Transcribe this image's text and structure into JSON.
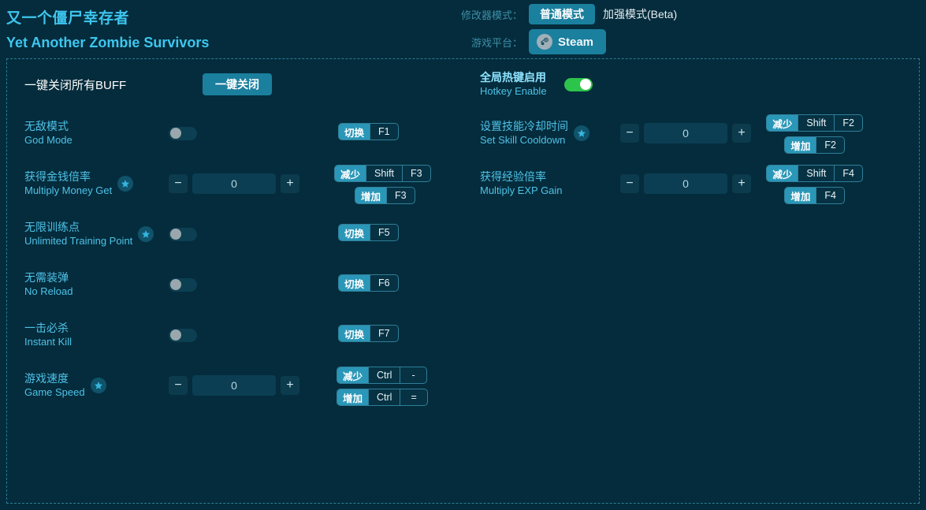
{
  "header": {
    "title_zh": "又一个僵尸幸存者",
    "title_en": "Yet Another Zombie Survivors",
    "mode_label": "修改器模式：",
    "mode_normal": "普通模式",
    "mode_enhanced": "加强模式(Beta)",
    "platform_label": "游戏平台：",
    "platform_value": "Steam",
    "platform_icon": "steam-icon"
  },
  "left": {
    "close_all_label": "一键关闭所有BUFF",
    "close_all_button": "一键关闭",
    "rows": [
      {
        "zh": "无敌模式",
        "en": "God Mode",
        "star": false,
        "control": "toggle",
        "toggle_on": false,
        "hotkeys": [
          {
            "action": "切换",
            "keys": [
              "F1"
            ]
          }
        ]
      },
      {
        "zh": "获得金钱倍率",
        "en": "Multiply Money Get",
        "star": true,
        "control": "stepper",
        "value": "0",
        "minus": "−",
        "plus": "+",
        "hotkeys": [
          {
            "action": "减少",
            "keys": [
              "Shift",
              "F3"
            ]
          },
          {
            "action": "增加",
            "keys": [
              "F3"
            ]
          }
        ]
      },
      {
        "zh": "无限训练点",
        "en": "Unlimited Training Point",
        "star": true,
        "control": "toggle",
        "toggle_on": false,
        "hotkeys": [
          {
            "action": "切换",
            "keys": [
              "F5"
            ]
          }
        ]
      },
      {
        "zh": "无需装弹",
        "en": "No Reload",
        "star": false,
        "control": "toggle",
        "toggle_on": false,
        "hotkeys": [
          {
            "action": "切换",
            "keys": [
              "F6"
            ]
          }
        ]
      },
      {
        "zh": "一击必杀",
        "en": "Instant Kill",
        "star": false,
        "control": "toggle",
        "toggle_on": false,
        "hotkeys": [
          {
            "action": "切换",
            "keys": [
              "F7"
            ]
          }
        ]
      },
      {
        "zh": "游戏速度",
        "en": "Game Speed",
        "star": true,
        "control": "stepper",
        "value": "0",
        "minus": "−",
        "plus": "+",
        "hotkeys": [
          {
            "action": "减少",
            "keys": [
              "Ctrl",
              "-"
            ]
          },
          {
            "action": "增加",
            "keys": [
              "Ctrl",
              "="
            ]
          }
        ]
      }
    ]
  },
  "right": {
    "hotkey_enable_zh": "全局热键启用",
    "hotkey_enable_en": "Hotkey Enable",
    "hotkey_enable_on": true,
    "rows": [
      {
        "zh": "设置技能冷却时间",
        "en": "Set Skill Cooldown",
        "star": true,
        "control": "stepper",
        "value": "0",
        "minus": "−",
        "plus": "+",
        "hotkeys": [
          {
            "action": "减少",
            "keys": [
              "Shift",
              "F2"
            ]
          },
          {
            "action": "增加",
            "keys": [
              "F2"
            ]
          }
        ]
      },
      {
        "zh": "获得经验倍率",
        "en": "Multiply EXP Gain",
        "star": false,
        "control": "stepper",
        "value": "0",
        "minus": "−",
        "plus": "+",
        "hotkeys": [
          {
            "action": "减少",
            "keys": [
              "Shift",
              "F4"
            ]
          },
          {
            "action": "增加",
            "keys": [
              "F4"
            ]
          }
        ]
      }
    ]
  },
  "colors": {
    "background": "#042c3c",
    "accent": "#1b7f9e",
    "label": "#4fc2e8",
    "toggle_on": "#2cc44a",
    "dashed_border": "#2a7e96"
  }
}
